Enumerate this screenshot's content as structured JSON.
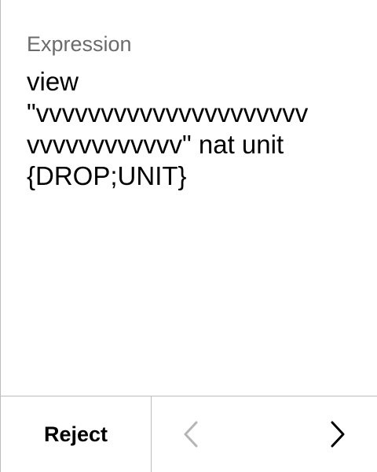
{
  "main": {
    "label": "Expression",
    "expression": "view\n\"vvvvvvvvvvvvvvvvvvvvv\nvvvvvvvvvvvv\" nat unit\n{DROP;UNIT}"
  },
  "footer": {
    "reject_label": "Reject",
    "prev_icon": "chevron-left-icon",
    "prev_state": "disabled",
    "next_icon": "chevron-right-icon",
    "next_state": "enabled"
  },
  "colors": {
    "divider": "#bdbdbd",
    "label_gray": "#6b6b6b",
    "disabled_icon": "#b5b5b5",
    "text": "#000000"
  }
}
